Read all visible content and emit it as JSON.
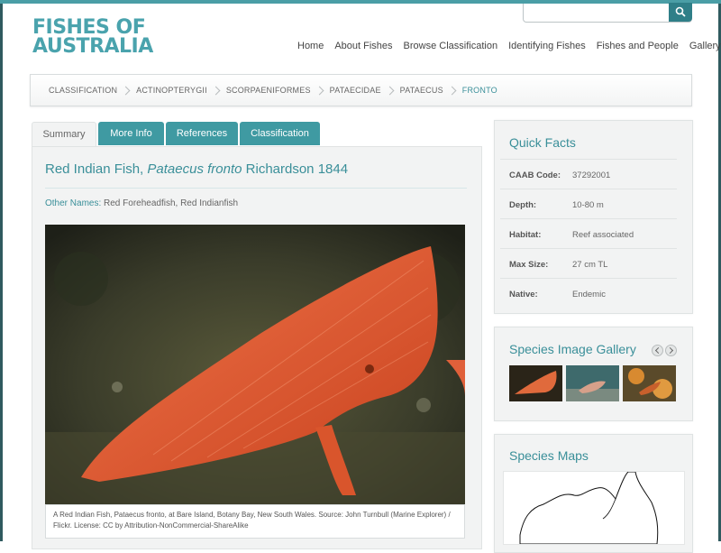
{
  "site": {
    "logo_line1": "FISHES OF",
    "logo_line2": "AUSTRALIA"
  },
  "search": {
    "placeholder": ""
  },
  "nav": [
    "Home",
    "About Fishes",
    "Browse Classification",
    "Identifying Fishes",
    "Fishes and People",
    "Gallery"
  ],
  "breadcrumb": [
    "CLASSIFICATION",
    "ACTINOPTERYGII",
    "SCORPAENIFORMES",
    "PATAECIDAE",
    "PATAECUS",
    "FRONTO"
  ],
  "tabs": [
    {
      "label": "Summary",
      "active": true
    },
    {
      "label": "More Info",
      "active": false
    },
    {
      "label": "References",
      "active": false
    },
    {
      "label": "Classification",
      "active": false
    }
  ],
  "species": {
    "common_name": "Red Indian Fish, ",
    "scientific_name": "Pataecus fronto",
    "author": " Richardson 1844",
    "other_names_label": "Other Names:",
    "other_names": " Red Foreheadfish, Red Indianfish",
    "caption": "A Red Indian Fish, Pataecus fronto, at Bare Island, Botany Bay, New South Wales. Source: John Turnbull (Marine Explorer) / Flickr. License: CC by Attribution-NonCommercial-ShareAlike"
  },
  "quick_facts": {
    "title": "Quick Facts",
    "items": [
      {
        "label": "CAAB Code:",
        "value": "37292001"
      },
      {
        "label": "Depth:",
        "value": "10-80 m"
      },
      {
        "label": "Habitat:",
        "value": "Reef associated"
      },
      {
        "label": "Max Size:",
        "value": "27 cm TL"
      },
      {
        "label": "Native:",
        "value": "Endemic"
      }
    ]
  },
  "gallery": {
    "title": "Species Image Gallery"
  },
  "maps": {
    "title": "Species Maps"
  },
  "colors": {
    "accent": "#3a8f99",
    "tab": "#3f9aa2",
    "panel": "#f2f3f3"
  }
}
